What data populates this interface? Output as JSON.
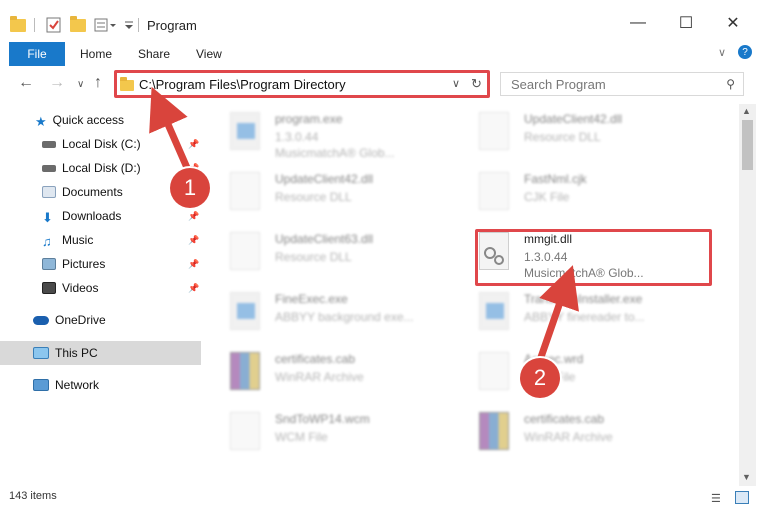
{
  "window": {
    "title": "Program",
    "minimize": "—",
    "maximize": "☐",
    "close": "✕"
  },
  "ribbon": {
    "tabs": [
      "File",
      "Home",
      "Share",
      "View"
    ]
  },
  "addressbar": {
    "path": "C:\\Program Files\\Program Directory",
    "search_placeholder": "Search Program"
  },
  "nav": {
    "items": [
      {
        "label": "Quick access"
      },
      {
        "label": "Local Disk (C:)"
      },
      {
        "label": "Local Disk (D:)"
      },
      {
        "label": "Documents"
      },
      {
        "label": "Downloads"
      },
      {
        "label": "Music"
      },
      {
        "label": "Pictures"
      },
      {
        "label": "Videos"
      },
      {
        "label": "OneDrive"
      },
      {
        "label": "This PC"
      },
      {
        "label": "Network"
      }
    ]
  },
  "files": [
    {
      "name": "program.exe",
      "line2": "1.3.0.44",
      "line3": "MusicmatchA® Glob..."
    },
    {
      "name": "UpdateClient42.dll",
      "line2": "Resource DLL",
      "line3": ""
    },
    {
      "name": "UpdateClient42.dll",
      "line2": "Resource DLL",
      "line3": ""
    },
    {
      "name": "FastNml.cjk",
      "line2": "CJK File",
      "line3": ""
    },
    {
      "name": "UpdateClient63.dll",
      "line2": "Resource DLL",
      "line3": ""
    },
    {
      "name": "mmgit.dll",
      "line2": "1.3.0.44",
      "line3": "MusicmatchA® Glob..."
    },
    {
      "name": "FineExec.exe",
      "line2": "ABBYY background exe...",
      "line3": ""
    },
    {
      "name": "TransformInstaller.exe",
      "line2": "ABBYY finereader to...",
      "line3": ""
    },
    {
      "name": "certificates.cab",
      "line2": "WinRAR Archive",
      "line3": ""
    },
    {
      "name": "Acrsec.wrd",
      "line2": "WRD File",
      "line3": ""
    },
    {
      "name": "SndToWP14.wcm",
      "line2": "WCM File",
      "line3": ""
    },
    {
      "name": "certificates.cab",
      "line2": "WinRAR Archive",
      "line3": ""
    }
  ],
  "status": {
    "count": "143 items"
  },
  "annotations": {
    "badge1": "1",
    "badge2": "2"
  },
  "colors": {
    "accent": "#1979ca",
    "highlight": "#e0474b",
    "selected": "#d9d9d9"
  }
}
